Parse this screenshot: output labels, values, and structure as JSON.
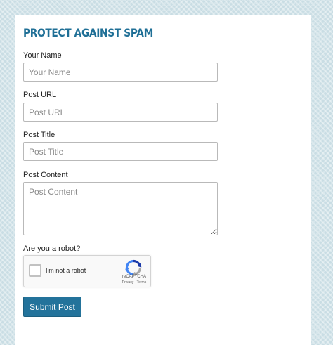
{
  "form": {
    "title": "PROTECT AGAINST SPAM",
    "name": {
      "label": "Your Name",
      "placeholder": "Your Name",
      "value": ""
    },
    "url": {
      "label": "Post URL",
      "placeholder": "Post URL",
      "value": ""
    },
    "post_title": {
      "label": "Post Title",
      "placeholder": "Post Title",
      "value": ""
    },
    "content": {
      "label": "Post Content",
      "placeholder": "Post Content",
      "value": ""
    },
    "robot_question": "Are you a robot?",
    "recaptcha": {
      "checkbox_label": "I'm not a robot",
      "checked": false,
      "brand": "reCAPTCHA",
      "privacy": "Privacy",
      "separator": "-",
      "terms": "Terms",
      "icon": "recaptcha-logo-icon"
    },
    "submit_label": "Submit Post"
  },
  "colors": {
    "accent": "#23739b",
    "title": "#1f6f96",
    "background": "#c9dde4"
  }
}
